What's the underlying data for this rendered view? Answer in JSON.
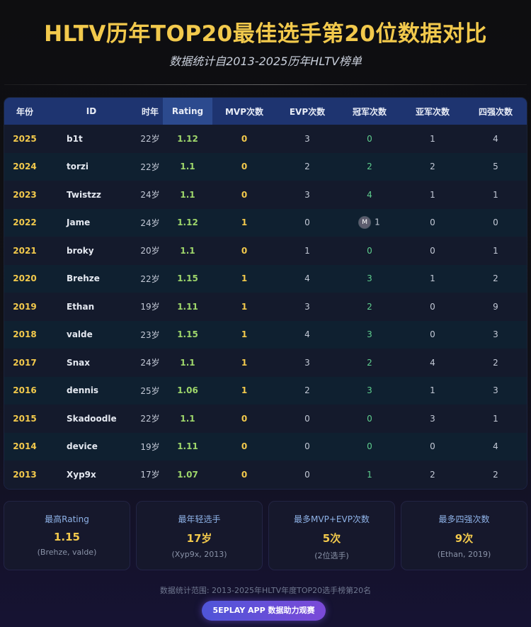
{
  "header": {
    "title": "HLTV历年TOP20最佳选手第20位数据对比",
    "subtitle": "数据统计自2013-2025历年HLTV榜单"
  },
  "table": {
    "columns": [
      "年份",
      "ID",
      "时年",
      "Rating",
      "MVP次数",
      "EVP次数",
      "冠军次数",
      "亚军次数",
      "四强次数"
    ],
    "rows": [
      {
        "year": "2025",
        "id": "b1t",
        "age": "22岁",
        "rating": "1.12",
        "mvp": "0",
        "evp": "3",
        "champ": "0",
        "runner": "1",
        "top4": "4"
      },
      {
        "year": "2024",
        "id": "torzi",
        "age": "22岁",
        "rating": "1.1",
        "mvp": "0",
        "evp": "2",
        "champ": "2",
        "runner": "2",
        "top4": "5"
      },
      {
        "year": "2023",
        "id": "Twistzz",
        "age": "24岁",
        "rating": "1.1",
        "mvp": "0",
        "evp": "3",
        "champ": "4",
        "runner": "1",
        "top4": "1"
      },
      {
        "year": "2022",
        "id": "Jame",
        "age": "24岁",
        "rating": "1.12",
        "mvp": "1",
        "evp": "0",
        "champ": "1",
        "runner": "0",
        "top4": "0",
        "badge": "M"
      },
      {
        "year": "2021",
        "id": "broky",
        "age": "20岁",
        "rating": "1.1",
        "mvp": "0",
        "evp": "1",
        "champ": "0",
        "runner": "0",
        "top4": "1"
      },
      {
        "year": "2020",
        "id": "Brehze",
        "age": "22岁",
        "rating": "1.15",
        "mvp": "1",
        "evp": "4",
        "champ": "3",
        "runner": "1",
        "top4": "2"
      },
      {
        "year": "2019",
        "id": "Ethan",
        "age": "19岁",
        "rating": "1.11",
        "mvp": "1",
        "evp": "3",
        "champ": "2",
        "runner": "0",
        "top4": "9"
      },
      {
        "year": "2018",
        "id": "valde",
        "age": "23岁",
        "rating": "1.15",
        "mvp": "1",
        "evp": "4",
        "champ": "3",
        "runner": "0",
        "top4": "3"
      },
      {
        "year": "2017",
        "id": "Snax",
        "age": "24岁",
        "rating": "1.1",
        "mvp": "1",
        "evp": "3",
        "champ": "2",
        "runner": "4",
        "top4": "2"
      },
      {
        "year": "2016",
        "id": "dennis",
        "age": "25岁",
        "rating": "1.06",
        "mvp": "1",
        "evp": "2",
        "champ": "3",
        "runner": "1",
        "top4": "3"
      },
      {
        "year": "2015",
        "id": "Skadoodle",
        "age": "22岁",
        "rating": "1.1",
        "mvp": "0",
        "evp": "0",
        "champ": "0",
        "runner": "3",
        "top4": "1"
      },
      {
        "year": "2014",
        "id": "device",
        "age": "19岁",
        "rating": "1.11",
        "mvp": "0",
        "evp": "0",
        "champ": "0",
        "runner": "0",
        "top4": "4"
      },
      {
        "year": "2013",
        "id": "Xyp9x",
        "age": "17岁",
        "rating": "1.07",
        "mvp": "0",
        "evp": "0",
        "champ": "1",
        "runner": "2",
        "top4": "2"
      }
    ]
  },
  "stats": [
    {
      "label": "最高Rating",
      "value": "1.15",
      "sub": "(Brehze, valde)"
    },
    {
      "label": "最年轻选手",
      "value": "17岁",
      "sub": "(Xyp9x, 2013)"
    },
    {
      "label": "最多MVP+EVP次数",
      "value": "5次",
      "sub": "(2位选手)"
    },
    {
      "label": "最多四强次数",
      "value": "9次",
      "sub": "(Ethan, 2019)"
    }
  ],
  "footer": {
    "note": "数据统计范围: 2013-2025年HLTV年度TOP20选手榜第20名",
    "app_button": "5EPLAY APP 数据助力观赛"
  },
  "colors": {
    "accent_gold": "#f2c94c",
    "rating_green": "#9ed66b",
    "header_blue": "#1e3470",
    "button_purple": "#5b50d8"
  }
}
